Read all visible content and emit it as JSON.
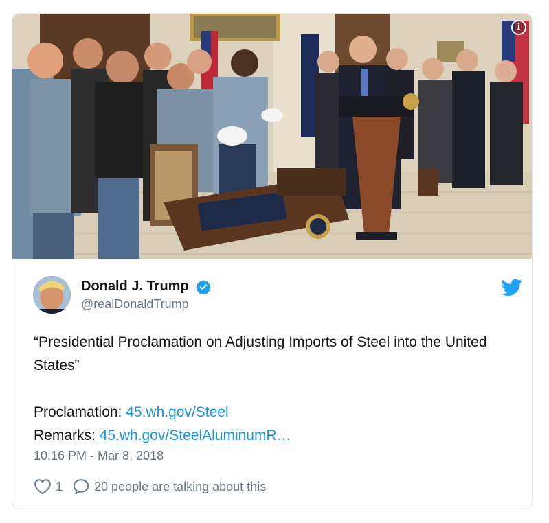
{
  "tweet": {
    "display_name": "Donald J. Trump",
    "handle": "@realDonaldTrump",
    "verified_icon": "verified-badge-icon",
    "platform_icon": "twitter-bird-icon",
    "info_icon_label": "i",
    "text_line1": "“Presidential Proclamation on Adjusting Imports of Steel into the United States”",
    "proclamation_label": "Proclamation: ",
    "proclamation_link": "45.wh.gov/Steel",
    "remarks_label": "Remarks: ",
    "remarks_link": "45.wh.gov/SteelAluminumR…",
    "timestamp": "10:16 PM - Mar 8, 2018",
    "like_count": "1",
    "talking_text": "20 people are talking about this"
  },
  "colors": {
    "link": "#1b95e0",
    "verified": "#1da1f2",
    "muted": "#657786",
    "border": "#e1e8ed"
  }
}
